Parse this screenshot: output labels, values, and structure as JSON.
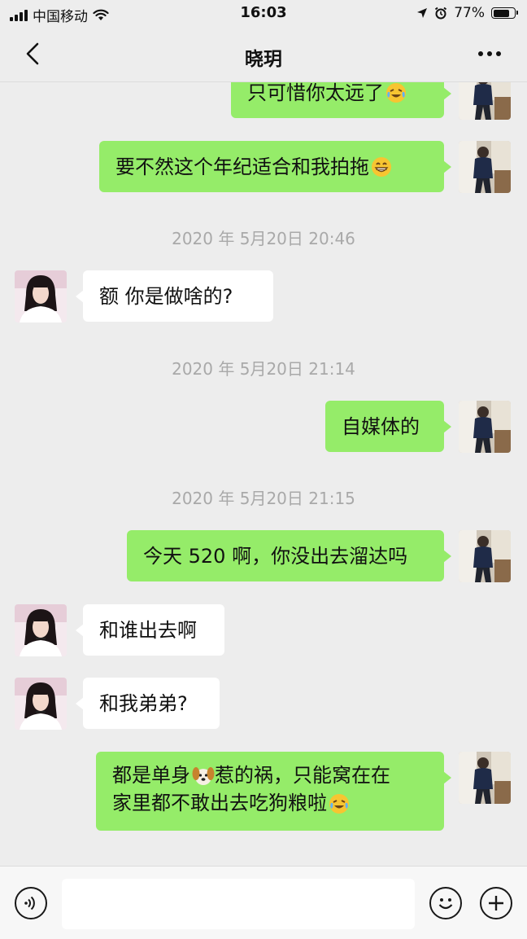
{
  "status_bar": {
    "carrier": "中国移动",
    "time": "16:03",
    "battery_percent": "77%",
    "battery_level": 0.77
  },
  "nav": {
    "title": "晓玥"
  },
  "messages": [
    {
      "from": "me",
      "text": "只可惜你太远了",
      "emoji": "crying-laughing-emoji"
    },
    {
      "from": "me",
      "text": "要不然这个年纪适合和我拍拖",
      "emoji": "grinning-emoji"
    },
    {
      "type": "timestamp",
      "text": "2020 年 5月20日 20:46"
    },
    {
      "from": "her",
      "text": "额  你是做啥的?"
    },
    {
      "type": "timestamp",
      "text": "2020 年 5月20日 21:14"
    },
    {
      "from": "me",
      "text": "自媒体的"
    },
    {
      "type": "timestamp",
      "text": "2020 年 5月20日 21:15"
    },
    {
      "from": "me",
      "text": "今天 520 啊，你没出去溜达吗"
    },
    {
      "from": "her",
      "text": "和谁出去啊"
    },
    {
      "from": "her",
      "text": "和我弟弟?"
    },
    {
      "from": "me",
      "line1_a": "都是单身",
      "line1_b": "惹的祸，只能窝在在",
      "line2": "家里都不敢出去吃狗粮啦",
      "emoji_inline": "dog-face-emoji",
      "emoji_end": "crying-laughing-emoji"
    }
  ],
  "colors": {
    "background": "#ededed",
    "my_bubble": "#95ec69",
    "her_bubble": "#ffffff",
    "timestamp_text": "#a9a9a9"
  },
  "input_bar": {
    "voice_icon": "voice-icon",
    "emoji_icon": "smile-icon",
    "plus_icon": "plus-icon"
  }
}
